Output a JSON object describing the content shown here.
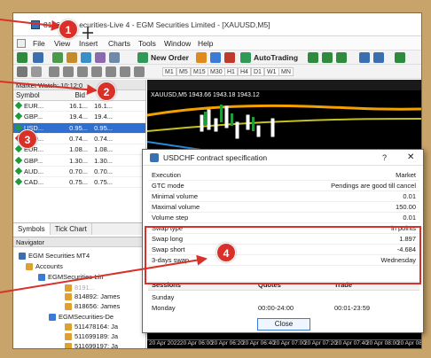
{
  "window": {
    "title_prefix": "8186",
    "title_rest": "ecurities-Live 4 - EGM Securities Limited - [XAUUSD,M5]"
  },
  "menu": {
    "items": [
      "File",
      "View",
      "Insert",
      "Charts",
      "Tools",
      "Window",
      "Help"
    ]
  },
  "toolbar": {
    "new_order": "New Order",
    "autotrading": "AutoTrading",
    "timeframes": [
      "M1",
      "M5",
      "M15",
      "M30",
      "H1",
      "H4",
      "D1",
      "W1",
      "MN"
    ]
  },
  "market_watch": {
    "title": "Market Watch: 10:12:0",
    "columns": [
      "Symbol",
      "Bid",
      "Ask"
    ],
    "rows": [
      {
        "symbol": "EUR...",
        "bid": "16.1...",
        "ask": "16.1...",
        "color": "#1e9c3a",
        "selected": false
      },
      {
        "symbol": "GBP...",
        "bid": "19.4...",
        "ask": "19.4...",
        "color": "#1e9c3a",
        "selected": false
      },
      {
        "symbol": "USD...",
        "bid": "0.95...",
        "ask": "0.95...",
        "color": "#1e9c3a",
        "selected": true
      },
      {
        "symbol": "AUD...",
        "bid": "0.74...",
        "ask": "0.74...",
        "color": "#d9312a",
        "selected": false
      },
      {
        "symbol": "EUR...",
        "bid": "1.08...",
        "ask": "1.08...",
        "color": "#1e9c3a",
        "selected": false
      },
      {
        "symbol": "GBP...",
        "bid": "1.30...",
        "ask": "1.30...",
        "color": "#1e9c3a",
        "selected": false
      },
      {
        "symbol": "AUD...",
        "bid": "0.70...",
        "ask": "0.70...",
        "color": "#1e9c3a",
        "selected": false
      },
      {
        "symbol": "CAD...",
        "bid": "0.75...",
        "ask": "0.75...",
        "color": "#1e9c3a",
        "selected": false
      }
    ],
    "tabs": [
      "Symbols",
      "Tick Chart"
    ]
  },
  "navigator": {
    "title": "Navigator",
    "root": "EGM Securities MT4",
    "accounts": "Accounts",
    "group1": "EGMSecurities-Lin",
    "group1_items": [
      "814892: James",
      "818656: James"
    ],
    "group2": "EGMSecurities-De",
    "group2_items": [
      "511478164: Ja",
      "511699189: Ja",
      "511699197: Ja"
    ]
  },
  "chart": {
    "label": "XAUUSD,M5  1943.66 1943.18 1943.12",
    "date_labels": [
      "20 Apr 2022",
      "20 Apr 06:00",
      "20 Apr 06:20",
      "20 Apr 06:40",
      "20 Apr 07:00",
      "20 Apr 07:20",
      "20 Apr 07:40",
      "20 Apr 08:00",
      "20 Apr 08:20"
    ]
  },
  "dialog": {
    "title": "USDCHF contract specification",
    "help": "?",
    "close_x": "✕",
    "properties": [
      {
        "key": "Execution",
        "value": "Market"
      },
      {
        "key": "GTC mode",
        "value": "Pendings are good till cancel"
      },
      {
        "key": "Minimal volume",
        "value": "0.01"
      },
      {
        "key": "Maximal volume",
        "value": "150.00"
      },
      {
        "key": "Volume step",
        "value": "0.01"
      },
      {
        "key": "Swap type",
        "value": "in points"
      },
      {
        "key": "Swap long",
        "value": "1.897"
      },
      {
        "key": "Swap short",
        "value": "-4.684"
      },
      {
        "key": "3-days swap",
        "value": "Wednesday"
      }
    ],
    "sessions_headers": [
      "Sessions",
      "Quotes",
      "Trade"
    ],
    "sessions": [
      {
        "day": "Sunday",
        "quotes": "",
        "trade": ""
      },
      {
        "day": "Monday",
        "quotes": "00:00-24:00",
        "trade": "00:01-23:59"
      }
    ],
    "close_button": "Close"
  },
  "callouts": [
    "1",
    "2",
    "3",
    "4"
  ]
}
